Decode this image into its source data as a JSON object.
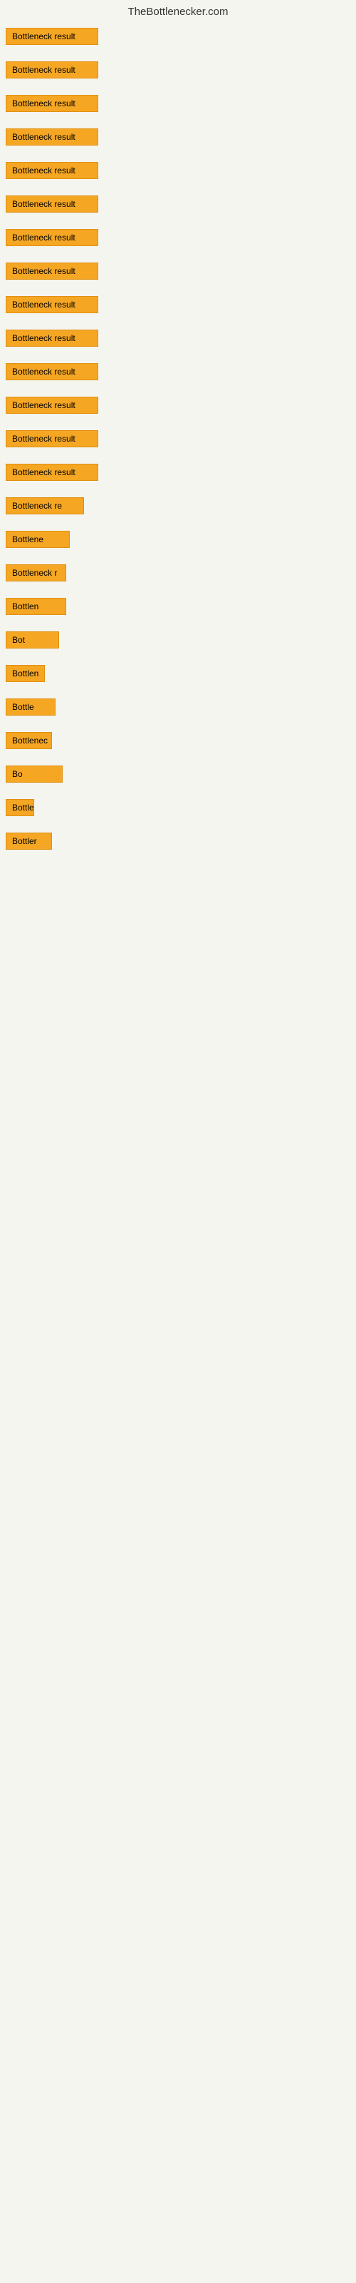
{
  "site": {
    "title": "TheBottlenecker.com"
  },
  "rows": [
    {
      "id": 1,
      "label": "Bottleneck result",
      "class": "row-1"
    },
    {
      "id": 2,
      "label": "Bottleneck result",
      "class": "row-2"
    },
    {
      "id": 3,
      "label": "Bottleneck result",
      "class": "row-3"
    },
    {
      "id": 4,
      "label": "Bottleneck result",
      "class": "row-4"
    },
    {
      "id": 5,
      "label": "Bottleneck result",
      "class": "row-5"
    },
    {
      "id": 6,
      "label": "Bottleneck result",
      "class": "row-6"
    },
    {
      "id": 7,
      "label": "Bottleneck result",
      "class": "row-7"
    },
    {
      "id": 8,
      "label": "Bottleneck result",
      "class": "row-8"
    },
    {
      "id": 9,
      "label": "Bottleneck result",
      "class": "row-9"
    },
    {
      "id": 10,
      "label": "Bottleneck result",
      "class": "row-10"
    },
    {
      "id": 11,
      "label": "Bottleneck result",
      "class": "row-11"
    },
    {
      "id": 12,
      "label": "Bottleneck result",
      "class": "row-12"
    },
    {
      "id": 13,
      "label": "Bottleneck result",
      "class": "row-13"
    },
    {
      "id": 14,
      "label": "Bottleneck result",
      "class": "row-14"
    },
    {
      "id": 15,
      "label": "Bottleneck re",
      "class": "row-15"
    },
    {
      "id": 16,
      "label": "Bottlene",
      "class": "row-16"
    },
    {
      "id": 17,
      "label": "Bottleneck r",
      "class": "row-17"
    },
    {
      "id": 18,
      "label": "Bottlen",
      "class": "row-18"
    },
    {
      "id": 19,
      "label": "Bot",
      "class": "row-19"
    },
    {
      "id": 20,
      "label": "Bottlen",
      "class": "row-20"
    },
    {
      "id": 21,
      "label": "Bottle",
      "class": "row-21"
    },
    {
      "id": 22,
      "label": "Bottlenec",
      "class": "row-22"
    },
    {
      "id": 23,
      "label": "Bo",
      "class": "row-23"
    },
    {
      "id": 24,
      "label": "Bottle",
      "class": "row-24"
    },
    {
      "id": 25,
      "label": "Bottler",
      "class": "row-25"
    }
  ],
  "colors": {
    "badge_bg": "#f5a623",
    "badge_border": "#e09010",
    "bg": "#f5f5f0",
    "title": "#333333"
  }
}
